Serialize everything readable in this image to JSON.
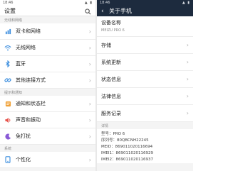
{
  "left": {
    "status_time": "18:46",
    "status_icons": "▲ ▮",
    "title": "设置",
    "sections": {
      "wireless": "无线和网络",
      "notify": "提示和通知",
      "system": "系统"
    },
    "items": {
      "sim": "双卡和网络",
      "wlan": "无线网络",
      "bluetooth": "蓝牙",
      "other_conn": "其他连接方式",
      "notification": "通知和状态栏",
      "sound": "声音和振动",
      "dnd": "免打扰",
      "personalize": "个性化"
    }
  },
  "right": {
    "status_time": "18:46",
    "status_icons": "▲ ▮",
    "title": "关于手机",
    "device_label": "设备名称",
    "device_value": "MEIZU PRO 6",
    "items": {
      "storage": "存储",
      "update": "系统更新",
      "status": "状态信息",
      "legal": "法律信息",
      "service": "服务记录"
    },
    "details_header": "详情",
    "details": {
      "model": "型号：PRO 6",
      "serial": "序列号：80QBCNH22245",
      "meid": "MEID：869011020116694",
      "imei1": "IMEI1：869011020116929",
      "imei2": "IMEI2：869011020116937"
    }
  },
  "colors": {
    "dark_header": "#1d2b3e",
    "chevron": "#a9a9a9",
    "section_text": "#8a8a8a"
  },
  "icons": [
    "search-icon",
    "sim-icon",
    "wifi-icon",
    "bluetooth-icon",
    "link-icon",
    "notification-icon",
    "sound-icon",
    "moon-icon",
    "personalize-icon",
    "back-arrow-icon",
    "chevron-right-icon"
  ]
}
